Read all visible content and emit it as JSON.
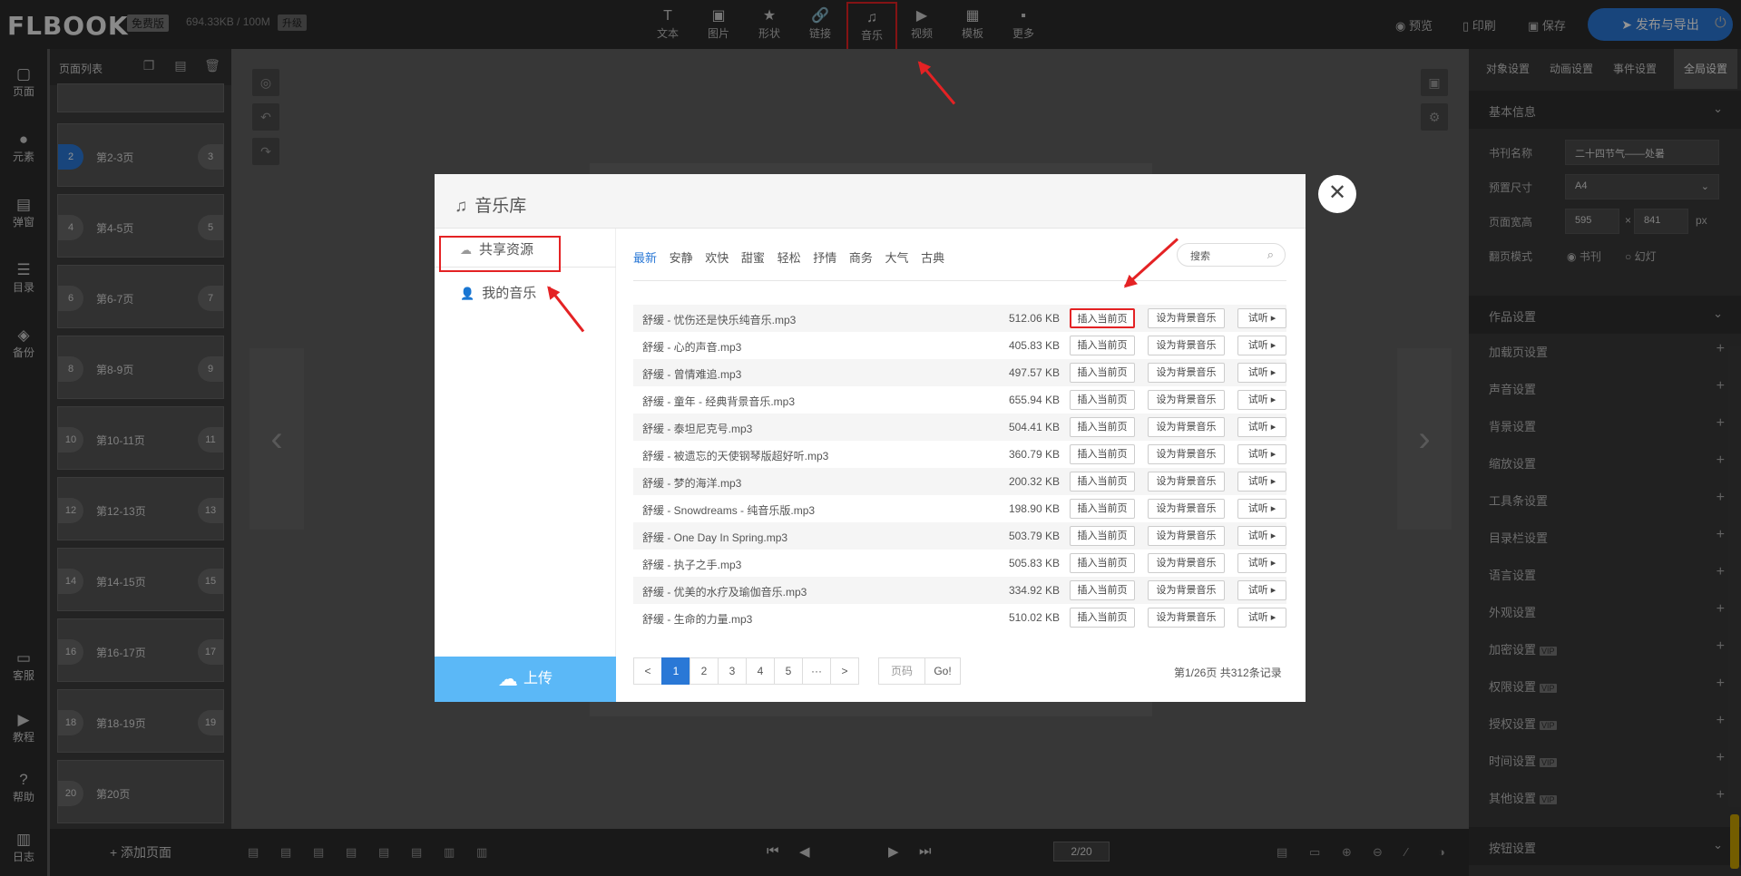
{
  "header": {
    "logo": "FLBOOK",
    "logo_mark": "®",
    "plan_badge": "免费版",
    "storage": "694.33KB / 100M",
    "upgrade_badge": "升级",
    "tools": [
      {
        "label": "文本",
        "icon": "text-icon",
        "glyph": "T"
      },
      {
        "label": "图片",
        "icon": "image-icon",
        "glyph": "▣"
      },
      {
        "label": "形状",
        "icon": "star-icon",
        "glyph": "★"
      },
      {
        "label": "链接",
        "icon": "link-icon",
        "glyph": "🔗"
      },
      {
        "label": "音乐",
        "icon": "music-note-icon",
        "glyph": "♫"
      },
      {
        "label": "视频",
        "icon": "play-circle-icon",
        "glyph": "▶"
      },
      {
        "label": "模板",
        "icon": "template-icon",
        "glyph": "▦"
      },
      {
        "label": "更多",
        "icon": "grid-more-icon",
        "glyph": "▪"
      }
    ],
    "preview": "预览",
    "print": "印刷",
    "save": "保存",
    "publish": "发布与导出"
  },
  "left_nav": [
    {
      "label": "页面",
      "icon": "page-icon",
      "glyph": "▢"
    },
    {
      "label": "元素",
      "icon": "elements-icon",
      "glyph": "●"
    },
    {
      "label": "弹窗",
      "icon": "popup-icon",
      "glyph": "▤"
    },
    {
      "label": "目录",
      "icon": "toc-icon",
      "glyph": "☰"
    },
    {
      "label": "备份",
      "icon": "backup-icon",
      "glyph": "◈"
    },
    {
      "label": "客服",
      "icon": "chat-icon",
      "glyph": "▭"
    },
    {
      "label": "教程",
      "icon": "tutorial-play-icon",
      "glyph": "▶"
    },
    {
      "label": "帮助",
      "icon": "help-icon",
      "glyph": "?"
    },
    {
      "label": "日志",
      "icon": "log-icon",
      "glyph": "▥"
    }
  ],
  "page_list": {
    "title": "页面列表",
    "pages": [
      {
        "left": "2",
        "label": "第2-3页",
        "right": "3",
        "selected": true
      },
      {
        "left": "4",
        "label": "第4-5页",
        "right": "5"
      },
      {
        "left": "6",
        "label": "第6-7页",
        "right": "7"
      },
      {
        "left": "8",
        "label": "第8-9页",
        "right": "9"
      },
      {
        "left": "10",
        "label": "第10-11页",
        "right": "11"
      },
      {
        "left": "12",
        "label": "第12-13页",
        "right": "13"
      },
      {
        "left": "14",
        "label": "第14-15页",
        "right": "15"
      },
      {
        "left": "16",
        "label": "第16-17页",
        "right": "17"
      },
      {
        "left": "18",
        "label": "第18-19页",
        "right": "19"
      },
      {
        "left": "20",
        "label": "第20页",
        "right": ""
      }
    ],
    "add_page": "添加页面"
  },
  "bottom_bar": {
    "page_indicator": "2/20"
  },
  "right_panel": {
    "tabs": [
      "对象设置",
      "动画设置",
      "事件设置",
      "全局设置"
    ],
    "active_tab": "全局设置",
    "basic_info": "基本信息",
    "book_name_label": "书刊名称",
    "book_name_value": "二十四节气——处暑",
    "preset_size_label": "预置尺寸",
    "preset_size_value": "A4",
    "page_size_label": "页面宽高",
    "page_width": "595",
    "page_height": "841",
    "size_times": "×",
    "unit": "px",
    "flip_mode_label": "翻页模式",
    "flip_mode_book": "书刊",
    "flip_mode_slide": "幻灯",
    "work_settings": "作品设置",
    "items": [
      {
        "label": "加载页设置",
        "vip": false
      },
      {
        "label": "声音设置",
        "vip": false
      },
      {
        "label": "背景设置",
        "vip": false
      },
      {
        "label": "缩放设置",
        "vip": false
      },
      {
        "label": "工具条设置",
        "vip": false
      },
      {
        "label": "目录栏设置",
        "vip": false
      },
      {
        "label": "语言设置",
        "vip": false
      },
      {
        "label": "外观设置",
        "vip": false
      },
      {
        "label": "加密设置",
        "vip": true
      },
      {
        "label": "权限设置",
        "vip": true
      },
      {
        "label": "授权设置",
        "vip": true
      },
      {
        "label": "时间设置",
        "vip": true
      },
      {
        "label": "其他设置",
        "vip": true
      }
    ],
    "vip_tag": "VIP",
    "button_settings": "按钮设置"
  },
  "music_modal": {
    "title": "音乐库",
    "sidebar": {
      "shared": "共享资源",
      "mine": "我的音乐",
      "upload": "上传"
    },
    "categories": [
      "最新",
      "安静",
      "欢快",
      "甜蜜",
      "轻松",
      "抒情",
      "商务",
      "大气",
      "古典"
    ],
    "active_category": "最新",
    "search_placeholder": "搜索",
    "buttons": {
      "insert": "插入当前页",
      "set_bg": "设为背景音乐",
      "listen": "试听"
    },
    "tracks": [
      {
        "name": "舒缓 - 忧伤还是快乐纯音乐.mp3",
        "size": "512.06 KB"
      },
      {
        "name": "舒缓 - 心的声音.mp3",
        "size": "405.83 KB"
      },
      {
        "name": "舒缓 - 曾情难追.mp3",
        "size": "497.57 KB"
      },
      {
        "name": "舒缓 - 童年 - 经典背景音乐.mp3",
        "size": "655.94 KB"
      },
      {
        "name": "舒缓 - 泰坦尼克号.mp3",
        "size": "504.41 KB"
      },
      {
        "name": "舒缓 - 被遗忘的天使钢琴版超好听.mp3",
        "size": "360.79 KB"
      },
      {
        "name": "舒缓 - 梦的海洋.mp3",
        "size": "200.32 KB"
      },
      {
        "name": "舒缓 - Snowdreams - 纯音乐版.mp3",
        "size": "198.90 KB"
      },
      {
        "name": "舒缓 - One Day In Spring.mp3",
        "size": "503.79 KB"
      },
      {
        "name": "舒缓 - 执子之手.mp3",
        "size": "505.83 KB"
      },
      {
        "name": "舒缓 - 优美的水疗及瑜伽音乐.mp3",
        "size": "334.92 KB"
      },
      {
        "name": "舒缓 - 生命的力量.mp3",
        "size": "510.02 KB"
      }
    ],
    "pagination": {
      "prev": "<",
      "pages": [
        "1",
        "2",
        "3",
        "4",
        "5"
      ],
      "ellipsis": "···",
      "next": ">",
      "current": "1",
      "page_input_placeholder": "页码",
      "go": "Go!",
      "summary": "第1/26页 共312条记录"
    }
  },
  "colors": {
    "accent": "#2a78d6",
    "annotation": "#e42224",
    "upload": "#5bb8f7"
  }
}
